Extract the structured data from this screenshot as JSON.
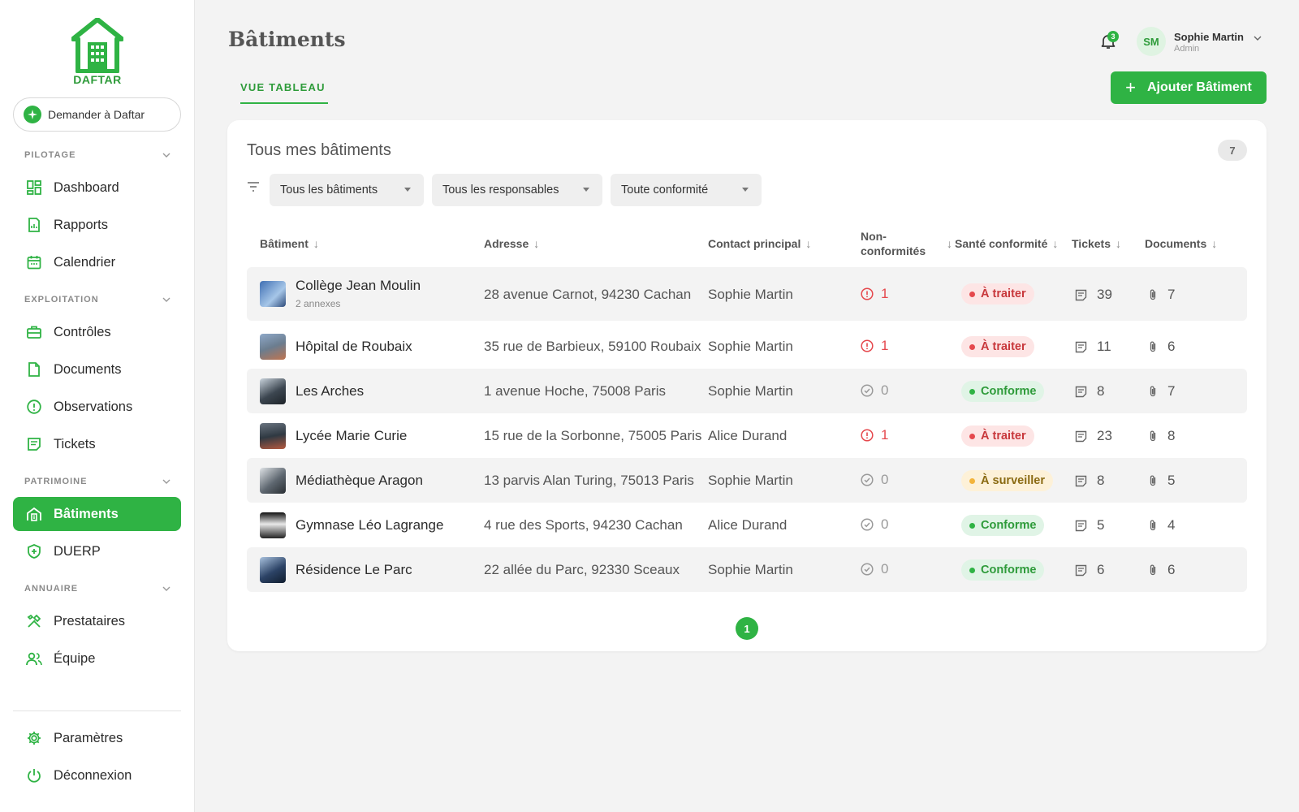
{
  "brand": {
    "name": "DAFTAR",
    "color": "#2fb344"
  },
  "sidebar": {
    "ask_label": "Demander à Daftar",
    "sections": {
      "pilotage": "PILOTAGE",
      "exploitation": "EXPLOITATION",
      "patrimoine": "PATRIMOINE",
      "annuaire": "ANNUAIRE"
    },
    "items": {
      "dashboard": "Dashboard",
      "rapports": "Rapports",
      "calendrier": "Calendrier",
      "controles": "Contrôles",
      "documents": "Documents",
      "observations": "Observations",
      "tickets": "Tickets",
      "batiments": "Bâtiments",
      "duerp": "DUERP",
      "prestataires": "Prestataires",
      "equipe": "Équipe",
      "parametres": "Paramètres",
      "deconnexion": "Déconnexion"
    }
  },
  "header": {
    "title": "Bâtiments",
    "notification_count": "3",
    "user": {
      "initials": "SM",
      "name": "Sophie Martin",
      "role": "Admin"
    },
    "tab": "VUE TABLEAU",
    "add_button": "Ajouter Bâtiment"
  },
  "card": {
    "title": "Tous mes bâtiments",
    "count": "7",
    "filters": {
      "batiments": "Tous les bâtiments",
      "responsables": "Tous les responsables",
      "conformite": "Toute conformité"
    },
    "columns": {
      "batiment": "Bâtiment",
      "adresse": "Adresse",
      "contact": "Contact principal",
      "nc_line1": "Non-",
      "nc_line2": "conformités",
      "sante": "Santé conformité",
      "tickets": "Tickets",
      "documents": "Documents"
    },
    "rows": [
      {
        "name": "Collège Jean Moulin",
        "sub": "2 annexes",
        "address": "28 avenue Carnot, 94230 Cachan",
        "contact": "Sophie Martin",
        "nc": "1",
        "status": "À traiter",
        "tickets": "39",
        "documents": "7"
      },
      {
        "name": "Hôpital de Roubaix",
        "sub": "",
        "address": "35 rue de Barbieux, 59100 Roubaix",
        "contact": "Sophie Martin",
        "nc": "1",
        "status": "À traiter",
        "tickets": "11",
        "documents": "6"
      },
      {
        "name": "Les Arches",
        "sub": "",
        "address": "1 avenue Hoche, 75008 Paris",
        "contact": "Sophie Martin",
        "nc": "0",
        "status": "Conforme",
        "tickets": "8",
        "documents": "7"
      },
      {
        "name": "Lycée Marie Curie",
        "sub": "",
        "address": "15 rue de la Sorbonne, 75005 Paris",
        "contact": "Alice Durand",
        "nc": "1",
        "status": "À traiter",
        "tickets": "23",
        "documents": "8"
      },
      {
        "name": "Médiathèque Aragon",
        "sub": "",
        "address": "13 parvis Alan Turing, 75013 Paris",
        "contact": "Sophie Martin",
        "nc": "0",
        "status": "À surveiller",
        "tickets": "8",
        "documents": "5"
      },
      {
        "name": "Gymnase Léo Lagrange",
        "sub": "",
        "address": "4 rue des Sports, 94230 Cachan",
        "contact": "Alice Durand",
        "nc": "0",
        "status": "Conforme",
        "tickets": "5",
        "documents": "4"
      },
      {
        "name": "Résidence Le Parc",
        "sub": "",
        "address": "22 allée du Parc, 92330 Sceaux",
        "contact": "Sophie Martin",
        "nc": "0",
        "status": "Conforme",
        "tickets": "6",
        "documents": "6"
      }
    ],
    "page": "1"
  }
}
